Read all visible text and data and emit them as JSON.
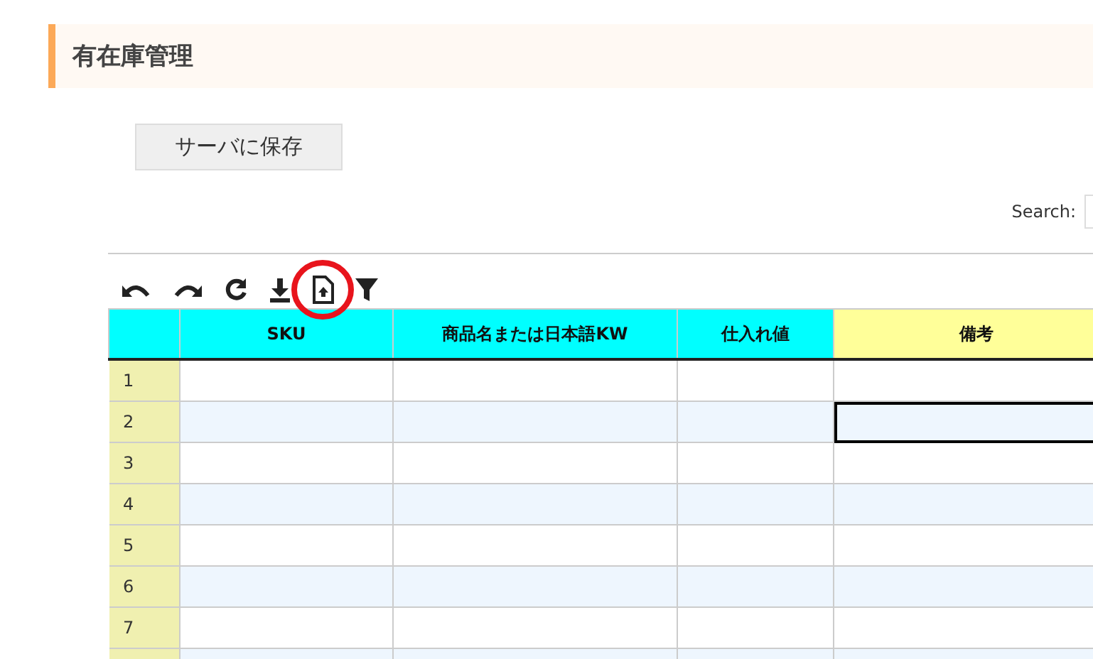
{
  "page_title": "有在庫管理",
  "save_button": "サーバに保存",
  "search": {
    "label": "Search:"
  },
  "toolbar": [
    {
      "kind": "undo",
      "circled": false
    },
    {
      "kind": "redo",
      "circled": false
    },
    {
      "kind": "reload",
      "circled": false
    },
    {
      "kind": "download",
      "circled": false
    },
    {
      "kind": "upload",
      "circled": true
    },
    {
      "kind": "filter",
      "circled": false
    }
  ],
  "table": {
    "columns": [
      {
        "color": "#00ffff"
      },
      {
        "label": "SKU",
        "color": "#00ffff"
      },
      {
        "label": "商品名または日本語KW",
        "color": "#00ffff"
      },
      {
        "label": "仕入れ値",
        "color": "#00ffff"
      },
      {
        "label": "備考",
        "color": "#ffff99"
      }
    ],
    "rows": [
      {
        "number": "1",
        "cells": [
          {
            "selected": false
          },
          {
            "selected": false
          },
          {
            "selected": false
          },
          {
            "selected": false
          }
        ]
      },
      {
        "number": "2",
        "cells": [
          {
            "selected": false
          },
          {
            "selected": false
          },
          {
            "selected": false
          },
          {
            "selected": true
          }
        ]
      },
      {
        "number": "3",
        "cells": [
          {
            "selected": false
          },
          {
            "selected": false
          },
          {
            "selected": false
          },
          {
            "selected": false
          }
        ]
      },
      {
        "number": "4",
        "cells": [
          {
            "selected": false
          },
          {
            "selected": false
          },
          {
            "selected": false
          },
          {
            "selected": false
          }
        ]
      },
      {
        "number": "5",
        "cells": [
          {
            "selected": false
          },
          {
            "selected": false
          },
          {
            "selected": false
          },
          {
            "selected": false
          }
        ]
      },
      {
        "number": "6",
        "cells": [
          {
            "selected": false
          },
          {
            "selected": false
          },
          {
            "selected": false
          },
          {
            "selected": false
          }
        ]
      },
      {
        "number": "7",
        "cells": [
          {
            "selected": false
          },
          {
            "selected": false
          },
          {
            "selected": false
          },
          {
            "selected": false
          }
        ]
      }
    ]
  }
}
